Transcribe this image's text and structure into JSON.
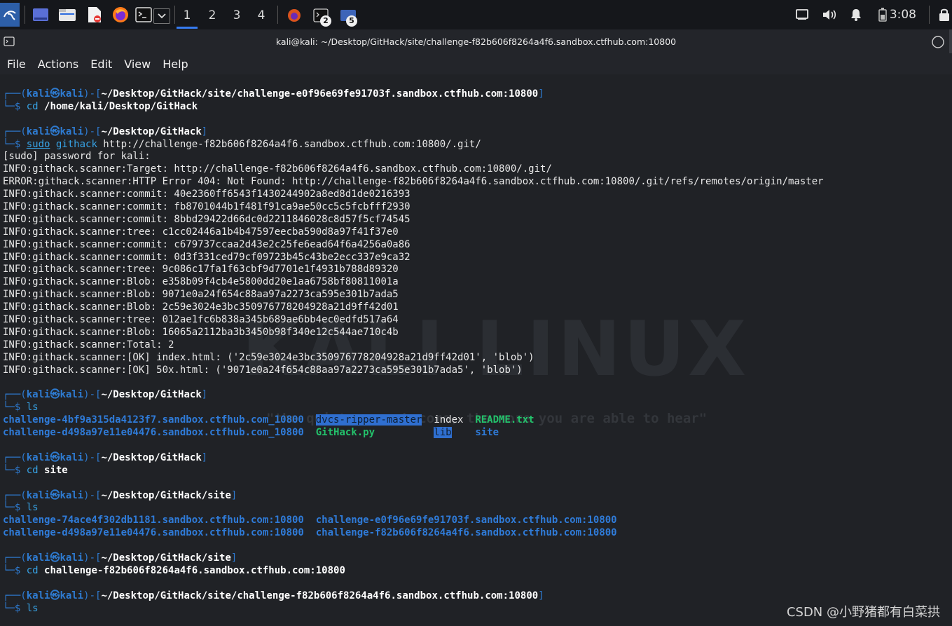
{
  "taskbar": {
    "workspaces": [
      "1",
      "2",
      "3",
      "4"
    ],
    "active_workspace": "1",
    "badge_terminals": "2",
    "badge_tasks": "5",
    "clock": "3:08",
    "accent": "#367bf0"
  },
  "window": {
    "title": "kali@kali: ~/Desktop/GitHack/site/challenge-f82b606f8264a4f6.sandbox.ctfhub.com:10800"
  },
  "menu": [
    "File",
    "Actions",
    "Edit",
    "View",
    "Help"
  ],
  "prompt": {
    "user": "kali",
    "host": "kali",
    "at": "㉿"
  },
  "terminal": {
    "blocks": [
      {
        "path": "~/Desktop/GitHack/site/challenge-e0f96e69fe91703f.sandbox.ctfhub.com:10800",
        "command": "cd /home/kali/Desktop/GitHack",
        "output": []
      },
      {
        "path": "~/Desktop/GitHack",
        "command": "sudo githack http://challenge-f82b606f8264a4f6.sandbox.ctfhub.com:10800/.git/",
        "output": [
          "[sudo] password for kali:",
          "INFO:githack.scanner:Target: http://challenge-f82b606f8264a4f6.sandbox.ctfhub.com:10800/.git/",
          "ERROR:githack.scanner:HTTP Error 404: Not Found: http://challenge-f82b606f8264a4f6.sandbox.ctfhub.com:10800/.git/refs/remotes/origin/master",
          "INFO:githack.scanner:commit: 40e2360ff6543f1430244902a8ed8d1de0216393",
          "INFO:githack.scanner:commit: fb8701044b1f481f91ca9ae50cc5c5fcbfff2930",
          "INFO:githack.scanner:commit: 8bbd29422d66dc0d2211846028c8d57f5cf74545",
          "INFO:githack.scanner:tree: c1cc02446a1b4b47597eecba590d8a97f41f37e0",
          "INFO:githack.scanner:commit: c679737ccaa2d43e2c25fe6ead64f6a4256a0a86",
          "INFO:githack.scanner:commit: 0d3f331ced79cf09723b45c43be2ecc337e9ca32",
          "INFO:githack.scanner:tree: 9c086c17fa1f63cbf9d7701e1f4931b788d89320",
          "INFO:githack.scanner:Blob: e358b09f4cb4e5800dd20e1aa6758bf80811001a",
          "INFO:githack.scanner:Blob: 9071e0a24f654c88aa97a2273ca595e301b7ada5",
          "INFO:githack.scanner:Blob: 2c59e3024e3bc350976778204928a21d9ff42d01",
          "INFO:githack.scanner:tree: 012ae1fc6b838a345b689ae6bb4ec0edfd517a64",
          "INFO:githack.scanner:Blob: 16065a2112ba3b3450b98f340e12c544ae710c4b",
          "INFO:githack.scanner:Total: 2",
          "INFO:githack.scanner:[OK] index.html: ('2c59e3024e3bc350976778204928a21d9ff42d01', 'blob')",
          "INFO:githack.scanner:[OK] 50x.html: ('9071e0a24f654c88aa97a2273ca595e301b7ada5', 'blob')"
        ]
      },
      {
        "path": "~/Desktop/GitHack",
        "command": "ls",
        "ls_rows": [
          [
            {
              "text": "challenge-4bf9a315da4123f7.sandbox.ctfhub.com_10800",
              "kind": "dir",
              "pad": "  "
            },
            {
              "text": "dvcs-ripper-master",
              "kind": "hl",
              "pad": "  "
            },
            {
              "text": "index",
              "kind": "plain",
              "pad": "  "
            },
            {
              "text": "README.txt",
              "kind": "exe",
              "pad": ""
            }
          ],
          [
            {
              "text": "challenge-d498a97e11e04476.sandbox.ctfhub.com_10800",
              "kind": "dir",
              "pad": "  "
            },
            {
              "text": "GitHack.py",
              "kind": "exe",
              "pad": "          "
            },
            {
              "text": "lib",
              "kind": "hl",
              "pad": "    "
            },
            {
              "text": "site",
              "kind": "dir",
              "pad": ""
            }
          ]
        ]
      },
      {
        "path": "~/Desktop/GitHack",
        "command": "cd site",
        "output": []
      },
      {
        "path": "~/Desktop/GitHack/site",
        "command": "ls",
        "ls_rows": [
          [
            {
              "text": "challenge-74ace4f302db1181.sandbox.ctfhub.com:10800",
              "kind": "dir",
              "pad": "  "
            },
            {
              "text": "challenge-e0f96e69fe91703f.sandbox.ctfhub.com:10800",
              "kind": "dir",
              "pad": ""
            }
          ],
          [
            {
              "text": "challenge-d498a97e11e04476.sandbox.ctfhub.com:10800",
              "kind": "dir",
              "pad": "  "
            },
            {
              "text": "challenge-f82b606f8264a4f6.sandbox.ctfhub.com:10800",
              "kind": "dir",
              "pad": ""
            }
          ]
        ]
      },
      {
        "path": "~/Desktop/GitHack/site",
        "command": "cd challenge-f82b606f8264a4f6.sandbox.ctfhub.com:10800",
        "output": []
      },
      {
        "path": "~/Desktop/GitHack/site/challenge-f82b606f8264a4f6.sandbox.ctfhub.com:10800",
        "command": "ls",
        "output": []
      }
    ],
    "watermark_title": "KALI LINUX",
    "watermark_sub": "\"the quieter you become, the more you are able to hear\""
  },
  "csdn_credit": "CSDN @小野猪都有白菜拱"
}
